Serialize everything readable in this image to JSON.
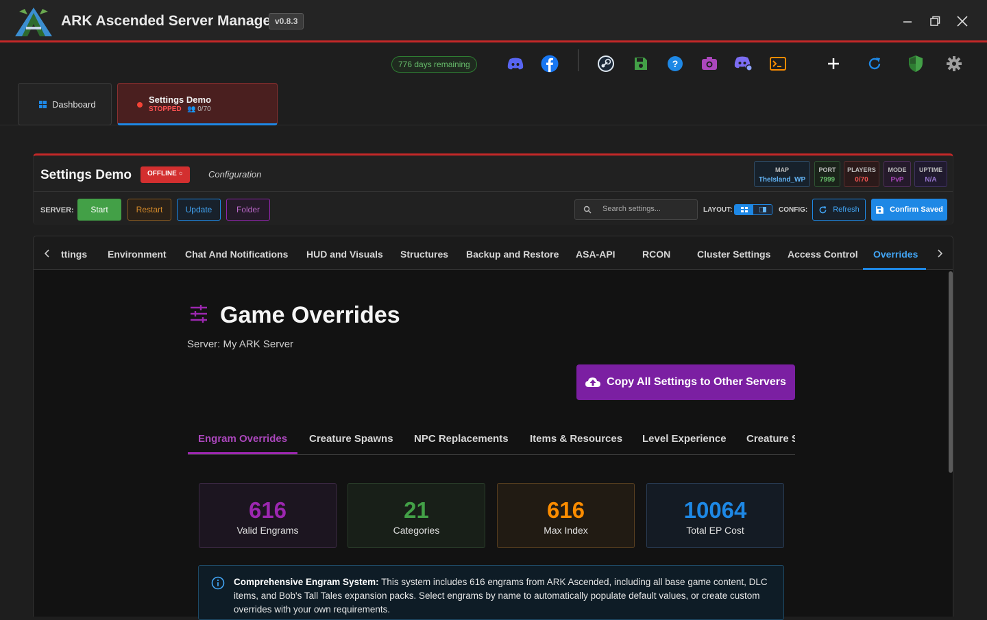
{
  "app": {
    "title": "ARK Ascended Server Manager",
    "version": "v0.8.3",
    "logo_icon": "ark-logo-icon"
  },
  "toolbar": {
    "license_days": "776 days remaining",
    "icons": [
      "discord-icon",
      "facebook-icon",
      "steam-icon",
      "save-icon",
      "help-icon",
      "camera-icon",
      "discord-bot-icon",
      "terminal-icon",
      "add-icon",
      "refresh-icon",
      "shield-icon",
      "gear-icon"
    ]
  },
  "tabs": {
    "dashboard": "Dashboard",
    "server": {
      "name": "Settings Demo",
      "status": "STOPPED",
      "players": "0/70"
    }
  },
  "panel": {
    "title": "Settings Demo",
    "status": "OFFLINE",
    "subtitle": "Configuration",
    "stats": [
      {
        "key": "MAP",
        "value": "TheIsland_WP"
      },
      {
        "key": "PORT",
        "value": "7999"
      },
      {
        "key": "PLAYERS",
        "value": "0/70"
      },
      {
        "key": "MODE",
        "value": "PvP"
      },
      {
        "key": "UPTIME",
        "value": "N/A"
      }
    ],
    "server_label": "SERVER:",
    "buttons": {
      "start": "Start",
      "restart": "Restart",
      "update": "Update",
      "folder": "Folder"
    },
    "search_placeholder": "Search settings...",
    "layout_label": "LAYOUT:",
    "config_label": "CONFIG:",
    "refresh": "Refresh",
    "confirm": "Confirm Saved"
  },
  "settings_tabs": [
    "ttings",
    "Environment",
    "Chat And Notifications",
    "HUD and Visuals",
    "Structures",
    "Backup and Restore",
    "ASA-API",
    "RCON",
    "Cluster Settings",
    "Access Control",
    "Overrides"
  ],
  "active_settings_tab": "Overrides",
  "overrides": {
    "title": "Game Overrides",
    "server_line": "Server: My ARK Server",
    "copy_button": "Copy All Settings to Other Servers",
    "subtabs": [
      "Engram Overrides",
      "Creature Spawns",
      "NPC Replacements",
      "Items & Resources",
      "Level Experience",
      "Creature S"
    ],
    "active_subtab": "Engram Overrides",
    "cards": [
      {
        "value": "616",
        "label": "Valid Engrams",
        "color": "#9c27b0"
      },
      {
        "value": "21",
        "label": "Categories",
        "color": "#43a047"
      },
      {
        "value": "616",
        "label": "Max Index",
        "color": "#fb8c00"
      },
      {
        "value": "10064",
        "label": "Total EP Cost",
        "color": "#1e88e5"
      }
    ],
    "info_title": "Comprehensive Engram System:",
    "info_text": "This system includes 616 engrams from ARK Ascended, including all base game content, DLC items, and Bob's Tall Tales expansion packs. Select engrams by name to automatically populate default values, or create custom overrides with your own requirements."
  },
  "colors": {
    "accent_red": "#c62828",
    "accent_blue": "#1e88e5",
    "accent_purple": "#7b1fa2",
    "success_green": "#43a047"
  }
}
